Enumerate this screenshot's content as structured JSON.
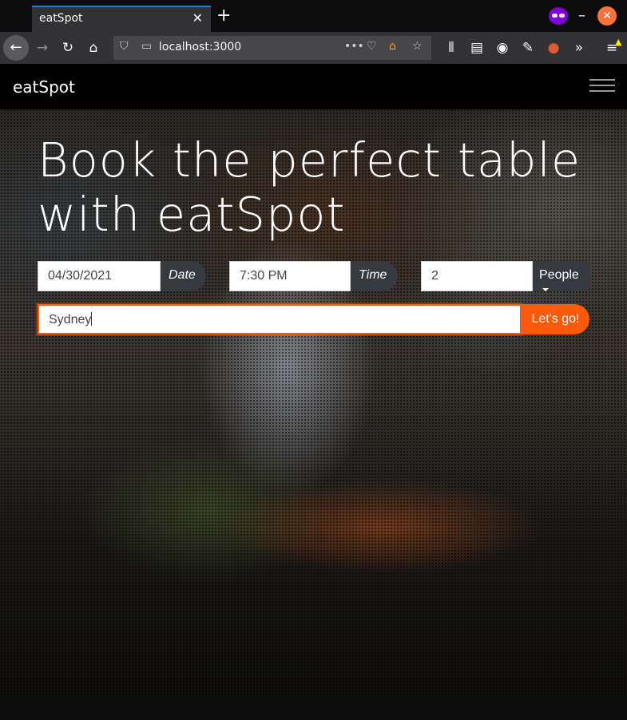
{
  "browser": {
    "tab_title": "eatSpot",
    "url": "localhost:3000",
    "icons": [
      "back-icon",
      "forward-icon",
      "reload-icon",
      "home-icon",
      "library-icon",
      "sidebar-icon",
      "account-icon",
      "extension-icon",
      "duckduckgo-icon",
      "overflow-icon",
      "menu-icon"
    ]
  },
  "site": {
    "brand": "eatSpot",
    "headline_line1": "Book the perfect table",
    "headline_line2": "with eatSpot"
  },
  "form": {
    "date_value": "04/30/2021",
    "date_label": "Date",
    "time_value": "7:30 PM",
    "time_label": "Time",
    "people_value": "2",
    "people_label": "People",
    "location_value": "Sydney",
    "submit_label": "Let's go!"
  },
  "colors": {
    "accent": "#fa5a0a",
    "addon_bg": "#343a40",
    "navbar_bg": "#000000"
  }
}
